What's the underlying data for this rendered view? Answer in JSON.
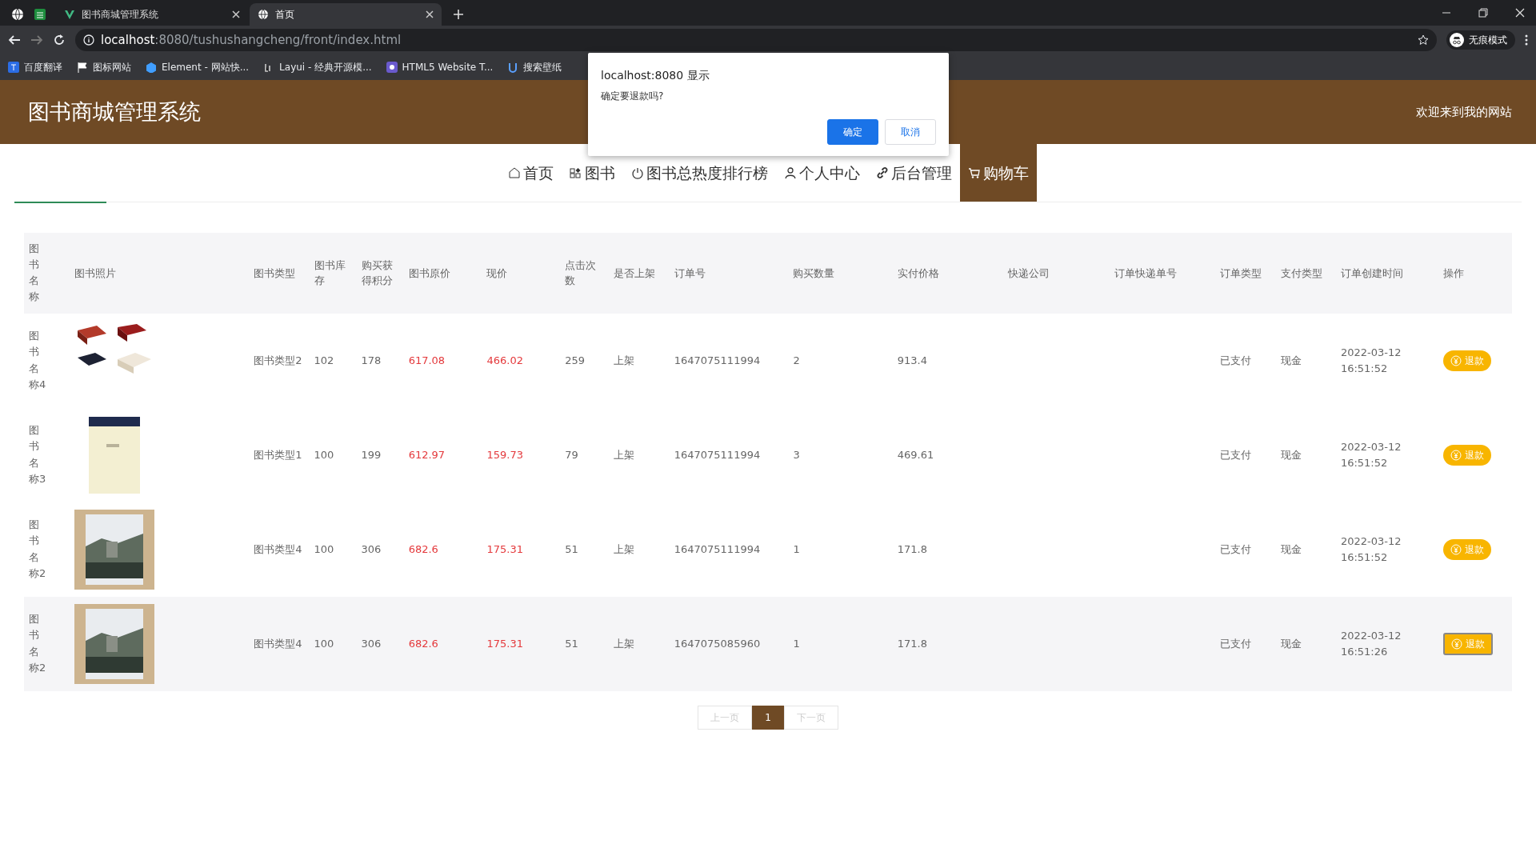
{
  "browser": {
    "tabs": [
      {
        "title": "图书商城管理系统",
        "selected": false
      },
      {
        "title": "首页",
        "selected": true
      }
    ],
    "address": {
      "host": "localhost",
      "rest": ":8080/tushushangcheng/front/index.html"
    },
    "profile": "无痕模式",
    "bookmarks": [
      "百度翻译",
      "图标网站",
      "Element - 网站快...",
      "Layui - 经典开源模...",
      "HTML5 Website T...",
      "搜索壁纸"
    ]
  },
  "dialog": {
    "title": "localhost:8080 显示",
    "message": "确定要退款吗?",
    "buttons": [
      {
        "label": "确定",
        "kind": "primary"
      },
      {
        "label": "取消",
        "kind": "secondary"
      }
    ]
  },
  "header": {
    "title": "图书商城管理系统",
    "welcome": "欢迎来到我的网站"
  },
  "nav": [
    {
      "label": "首页",
      "selected": false
    },
    {
      "label": "图书",
      "selected": false
    },
    {
      "label": "图书总热度排行榜",
      "selected": false
    },
    {
      "label": "个人中心",
      "selected": false
    },
    {
      "label": "后台管理",
      "selected": false
    },
    {
      "label": "购物车",
      "selected": true
    }
  ],
  "table": {
    "columns": [
      "图书名称",
      "图书照片",
      "图书类型",
      "图书库存",
      "购买获得积分",
      "图书原价",
      "现价",
      "点击次数",
      "是否上架",
      "订单号",
      "购买数量",
      "实付价格",
      "快递公司",
      "订单快递单号",
      "订单类型",
      "支付类型",
      "订单创建时间",
      "操作"
    ],
    "rows": [
      {
        "name": "图书名称4",
        "type": "图书类型2",
        "stock": "102",
        "points": "178",
        "original_price": "617.08",
        "price": "466.02",
        "clicks": "259",
        "on_shelf": "上架",
        "order_no": "1647075111994",
        "quantity": "2",
        "paid": "913.4",
        "order_type": "已支付",
        "pay_type": "现金",
        "created": "2022-03-12 16:51:52",
        "action": {
          "label": "退款",
          "focused": false
        }
      },
      {
        "name": "图书名称3",
        "type": "图书类型1",
        "stock": "100",
        "points": "199",
        "original_price": "612.97",
        "price": "159.73",
        "clicks": "79",
        "on_shelf": "上架",
        "order_no": "1647075111994",
        "quantity": "3",
        "paid": "469.61",
        "order_type": "已支付",
        "pay_type": "现金",
        "created": "2022-03-12 16:51:52",
        "action": {
          "label": "退款",
          "focused": false
        }
      },
      {
        "name": "图书名称2",
        "type": "图书类型4",
        "stock": "100",
        "points": "306",
        "original_price": "682.6",
        "price": "175.31",
        "clicks": "51",
        "on_shelf": "上架",
        "order_no": "1647075111994",
        "quantity": "1",
        "paid": "171.8",
        "order_type": "已支付",
        "pay_type": "现金",
        "created": "2022-03-12 16:51:52",
        "action": {
          "label": "退款",
          "focused": false
        }
      },
      {
        "name": "图书名称2",
        "type": "图书类型4",
        "stock": "100",
        "points": "306",
        "original_price": "682.6",
        "price": "175.31",
        "clicks": "51",
        "on_shelf": "上架",
        "order_no": "1647075085960",
        "quantity": "1",
        "paid": "171.8",
        "order_type": "已支付",
        "pay_type": "现金",
        "created": "2022-03-12 16:51:26",
        "action": {
          "label": "退款",
          "focused": true
        }
      }
    ]
  },
  "pagination": {
    "prev": {
      "label": "上一页",
      "disabled": true
    },
    "pages": [
      {
        "label": "1",
        "selected": true
      }
    ],
    "next": {
      "label": "下一页",
      "disabled": true
    }
  }
}
